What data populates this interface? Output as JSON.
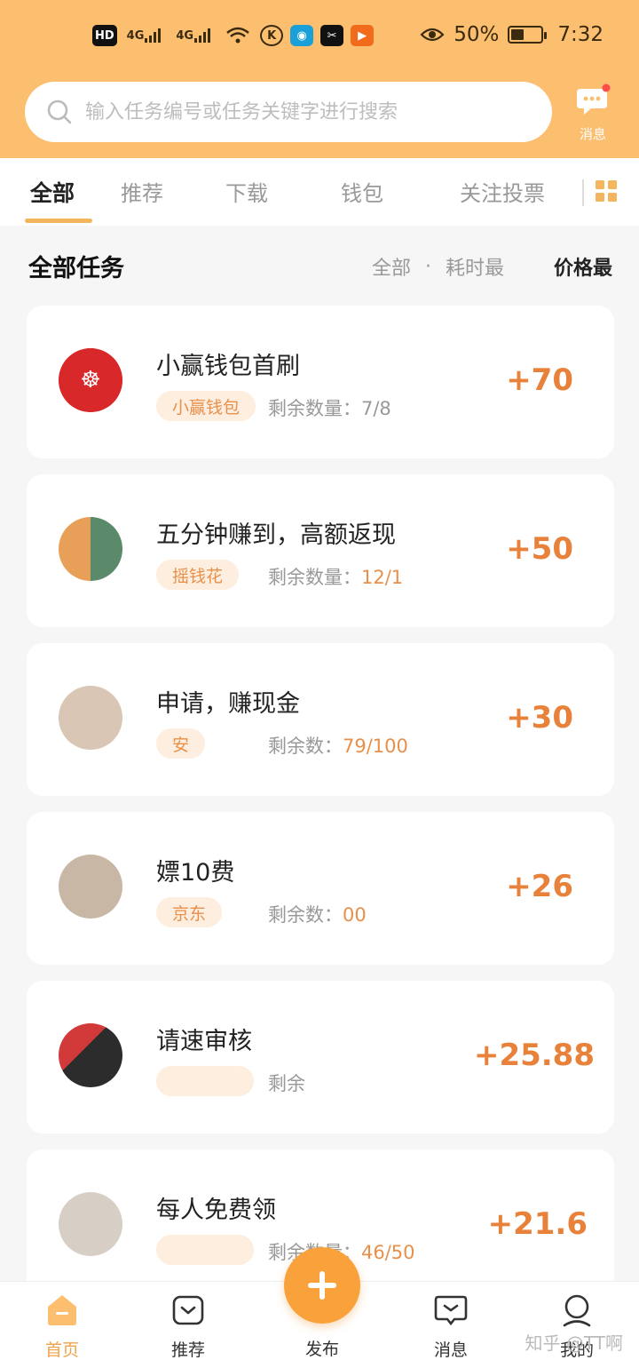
{
  "status_bar": {
    "network_icons": [
      "HD",
      "4G",
      "4G"
    ],
    "battery_percent": "50%",
    "time": "7:32"
  },
  "search": {
    "placeholder": "输入任务编号或任务关键字进行搜索"
  },
  "header_message": {
    "label": "消息"
  },
  "tabs": [
    {
      "label": "全部",
      "active": true
    },
    {
      "label": "推荐",
      "active": false
    },
    {
      "label": "下载",
      "active": false
    },
    {
      "label": "钱包",
      "active": false
    },
    {
      "label": "关注投票",
      "active": false
    }
  ],
  "section": {
    "title": "全部任务",
    "sort_all": "全部",
    "sort_time": "耗时最",
    "sort_price": "价格最"
  },
  "tasks": [
    {
      "title": "小赢钱包首刷",
      "tag": "小赢钱包",
      "remain_label": "剩余数量：",
      "remain_value": "7/8",
      "price": "+70",
      "avatar_color": "#d8282a"
    },
    {
      "title": "五分钟赚到，高额返现",
      "tag": "摇钱花",
      "remain_label": "剩余数量：",
      "remain_value": "12/1",
      "price": "+50",
      "avatar_color": "#e8a058"
    },
    {
      "title": "申请，赚现金",
      "tag": "安",
      "remain_label": "剩余数：",
      "remain_value": "79/100",
      "price": "+30",
      "avatar_color": "#d9c6b4"
    },
    {
      "title": "嫖10费",
      "tag": "京东",
      "remain_label": "剩余数：",
      "remain_value": "00",
      "price": "+26",
      "avatar_color": "#c8b7a4"
    },
    {
      "title": "请速审核",
      "tag": "",
      "remain_label": "剩余",
      "remain_value": "",
      "price": "+25.88",
      "avatar_color": "#2c2c2c"
    },
    {
      "title": "每人免费领",
      "tag": "",
      "remain_label": "剩余数量：",
      "remain_value": "46/50",
      "price": "+21.6",
      "avatar_color": "#d7cfc6"
    }
  ],
  "bottom_nav": {
    "home": "首页",
    "recommend": "推荐",
    "publish": "发布",
    "messages": "消息",
    "mine": "我的"
  },
  "watermark": "知乎 @TT啊",
  "colors": {
    "header_bg": "#fbbf6f",
    "accent": "#e8823a",
    "tag_bg": "#fdeedf"
  }
}
